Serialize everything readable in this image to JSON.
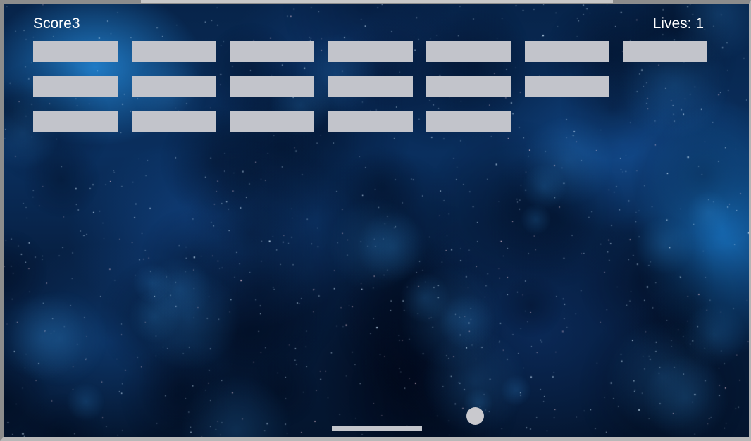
{
  "hud": {
    "score_label": "Score3",
    "lives_label": "Lives: 1"
  },
  "bricks": {
    "rows": [
      7,
      6,
      5
    ],
    "color": "#c2c4cb"
  },
  "colors": {
    "background": "#07244a",
    "paddle": "#c4c6cc",
    "ball": "#c9c9ce",
    "text": "#ffffff"
  }
}
